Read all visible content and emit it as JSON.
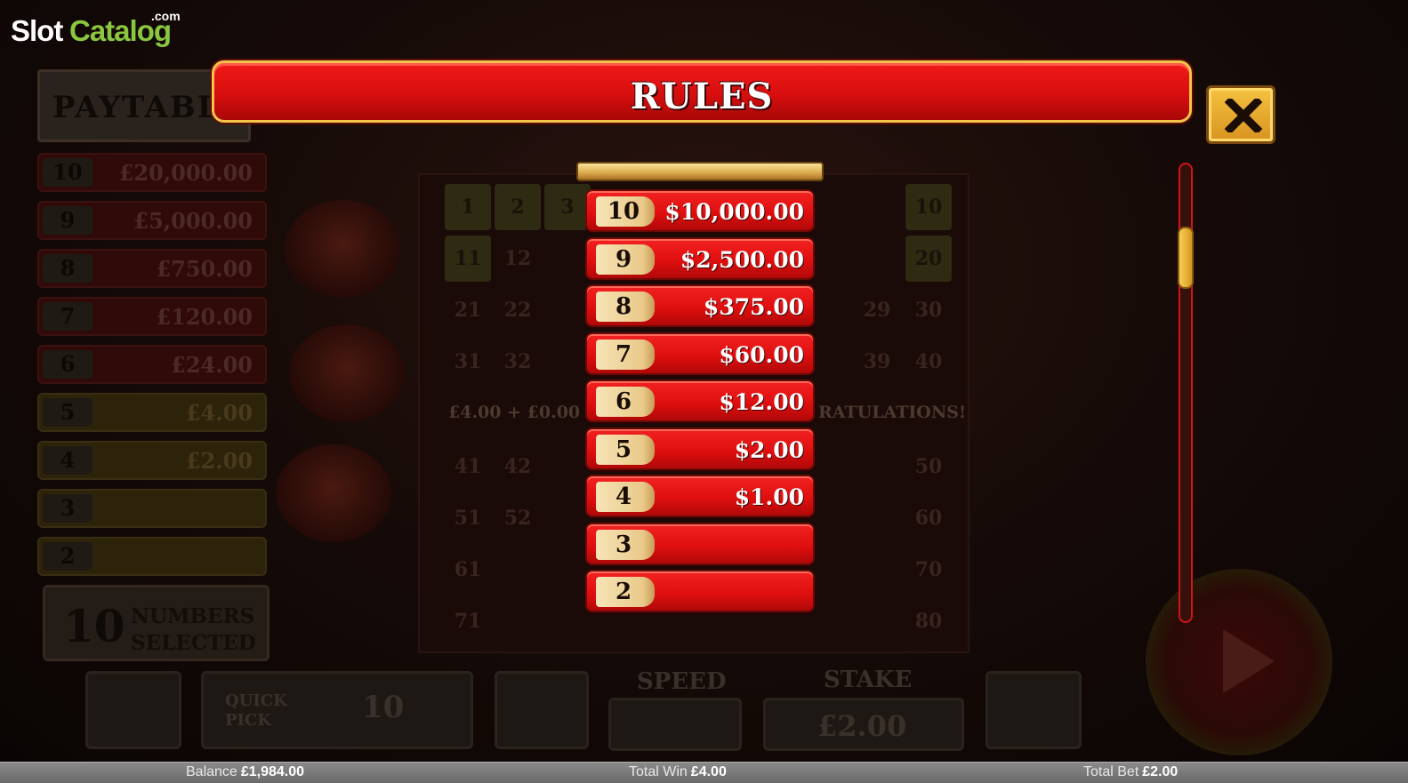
{
  "logo": {
    "slot": "Slot",
    "catalog": "Catalog",
    "com": ".com"
  },
  "modal": {
    "title": "RULES",
    "close_icon": "close-x-icon",
    "prizes": [
      {
        "hits": "10",
        "amount": "$10,000.00"
      },
      {
        "hits": "9",
        "amount": "$2,500.00"
      },
      {
        "hits": "8",
        "amount": "$375.00"
      },
      {
        "hits": "7",
        "amount": "$60.00"
      },
      {
        "hits": "6",
        "amount": "$12.00"
      },
      {
        "hits": "5",
        "amount": "$2.00"
      },
      {
        "hits": "4",
        "amount": "$1.00"
      },
      {
        "hits": "3",
        "amount": ""
      },
      {
        "hits": "2",
        "amount": ""
      }
    ]
  },
  "background": {
    "paytable_title": "PAYTABLE",
    "paytable_rows": [
      {
        "hits": "10",
        "amount": "£20,000.00"
      },
      {
        "hits": "9",
        "amount": "£5,000.00"
      },
      {
        "hits": "8",
        "amount": "£750.00"
      },
      {
        "hits": "7",
        "amount": "£120.00"
      },
      {
        "hits": "6",
        "amount": "£24.00"
      },
      {
        "hits": "5",
        "amount": "£4.00"
      },
      {
        "hits": "4",
        "amount": "£2.00"
      },
      {
        "hits": "3",
        "amount": ""
      },
      {
        "hits": "2",
        "amount": ""
      }
    ],
    "numbers_selected_count": "10",
    "numbers_selected_label_1": "NUMBERS",
    "numbers_selected_label_2": "SELECTED",
    "win_message": "£4.00 + £0.00",
    "congrats_message": "RATULATIONS!",
    "quick_pick_label": "QUICK PICK",
    "pick_count": "10",
    "speed_label": "SPEED",
    "stake_label": "STAKE",
    "stake_value": "£2.00"
  },
  "footer": {
    "balance_label": "Balance",
    "balance_value": "£1,984.00",
    "win_label": "Total Win",
    "win_value": "£4.00",
    "bet_label": "Total Bet",
    "bet_value": "£2.00"
  },
  "colors": {
    "modal_red": "#e00f0f",
    "gold": "#f3c34a",
    "logo_green": "#8bc63f"
  }
}
